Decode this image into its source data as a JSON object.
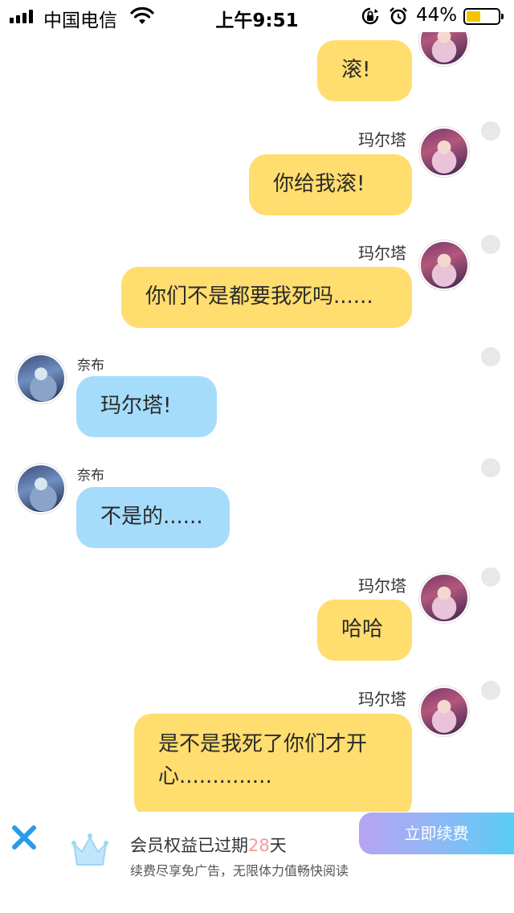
{
  "status_bar": {
    "carrier": "中国电信",
    "time": "上午9:51",
    "battery_percent": "44%",
    "battery_level": 0.44,
    "icons": [
      "signal-icon",
      "wifi-icon",
      "rotation-lock-icon",
      "alarm-icon",
      "battery-icon"
    ]
  },
  "messages": [
    {
      "sender": "",
      "side": "right",
      "text": "滚!"
    },
    {
      "sender": "玛尔塔",
      "side": "right",
      "text": "你给我滚!"
    },
    {
      "sender": "玛尔塔",
      "side": "right",
      "text": "你们不是都要我死吗......"
    },
    {
      "sender": "奈布",
      "side": "left",
      "text": "玛尔塔!"
    },
    {
      "sender": "奈布",
      "side": "left",
      "text": "不是的......"
    },
    {
      "sender": "玛尔塔",
      "side": "right",
      "text": "哈哈"
    },
    {
      "sender": "玛尔塔",
      "side": "right",
      "text": "是不是我死了你们才开心.............."
    }
  ],
  "banner": {
    "title_prefix": "会员权益已过期",
    "days": "28",
    "title_suffix": "天",
    "subtitle": "续费尽享免广告，无限体力值畅快阅读",
    "renew_label": "立即续费",
    "accent_color": "#f59a9a"
  },
  "colors": {
    "right_bubble": "#ffdd6e",
    "left_bubble": "#a6dcfb"
  }
}
